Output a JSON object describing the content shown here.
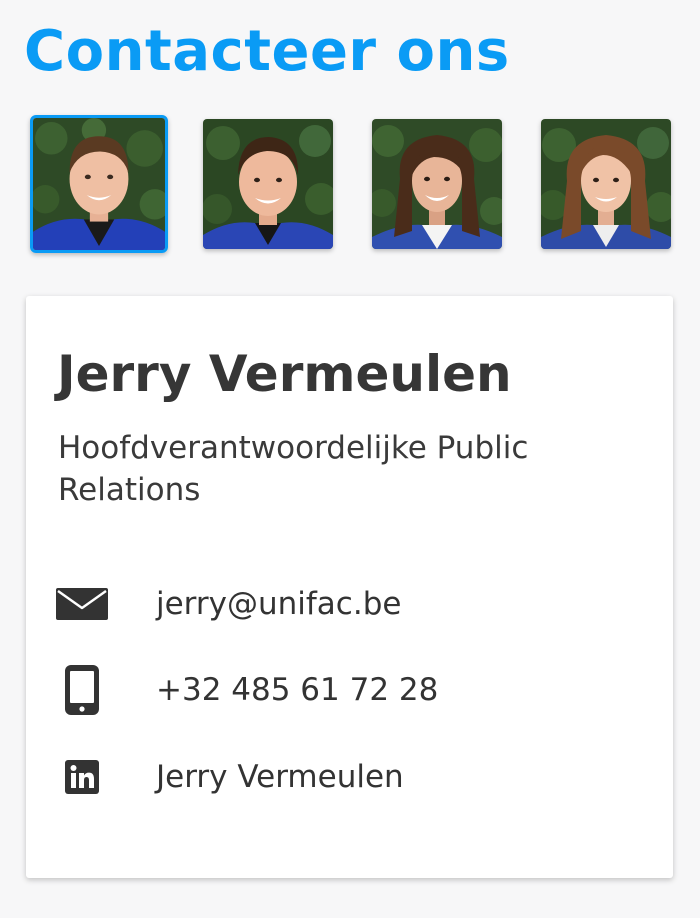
{
  "header": {
    "title": "Contacteer ons"
  },
  "team": {
    "members": [
      {
        "name": "Jerry Vermeulen",
        "selected": true
      },
      {
        "name": "",
        "selected": false
      },
      {
        "name": "",
        "selected": false
      },
      {
        "name": "",
        "selected": false
      }
    ]
  },
  "contact_card": {
    "name": "Jerry Vermeulen",
    "role": "Hoofdverantwoordelijke Public Relations",
    "email": "jerry@unifac.be",
    "phone": "+32 485 61 72 28",
    "linkedin": "Jerry Vermeulen"
  },
  "icons": {
    "email": "envelope-icon",
    "phone": "mobile-phone-icon",
    "linkedin": "linkedin-icon"
  },
  "colors": {
    "accent": "#0a9bf5",
    "text": "#363636",
    "icon": "#333333",
    "card_background": "#ffffff",
    "page_background": "#f7f7f8"
  }
}
